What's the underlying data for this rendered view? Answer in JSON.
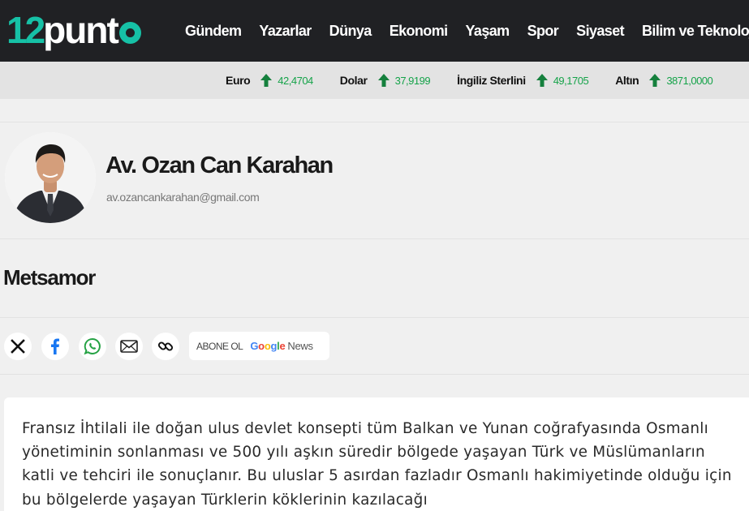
{
  "header": {
    "logo": {
      "number": "12",
      "word": "punt"
    },
    "nav": [
      "Gündem",
      "Yazarlar",
      "Dünya",
      "Ekonomi",
      "Yaşam",
      "Spor",
      "Siyaset",
      "Bilim ve Teknoloji"
    ]
  },
  "ticker": {
    "items": [
      {
        "name": "Euro",
        "value": "42,4704",
        "trend": "up"
      },
      {
        "name": "Dolar",
        "value": "37,9199",
        "trend": "up"
      },
      {
        "name": "İngiliz Sterlini",
        "value": "49,1705",
        "trend": "up"
      },
      {
        "name": "Altın",
        "value": "3871,0000",
        "trend": "up"
      }
    ],
    "up_color": "#16a34a"
  },
  "author": {
    "name": "Av. Ozan Can Karahan",
    "email": "av.ozancankarahan@gmail.com"
  },
  "article": {
    "title": "Metsamor",
    "body": "Fransız İhtilali ile doğan ulus devlet konsepti tüm Balkan ve Yunan coğrafyasında Osmanlı yönetiminin sonlanması ve 500 yılı aşkın süredir bölgede yaşayan Türk ve Müslümanların katli ve tehciri ile sonuçlanır. Bu uluslar 5 asırdan fazladır Osmanlı hakimiyetinde olduğu için bu bölgelerde yaşayan Türklerin köklerinin kazılacağı"
  },
  "share": {
    "icons": [
      "x-icon",
      "facebook-icon",
      "whatsapp-icon",
      "mail-icon",
      "link-icon"
    ],
    "subscribe_label": "ABONE OL",
    "google_word": [
      "G",
      "o",
      "o",
      "g",
      "l",
      "e"
    ],
    "news_word": "News"
  },
  "colors": {
    "brand": "#16c1a6",
    "header_bg": "#202124",
    "ticker_bg": "#e3e3e3",
    "page_bg": "#f0f0f0"
  }
}
